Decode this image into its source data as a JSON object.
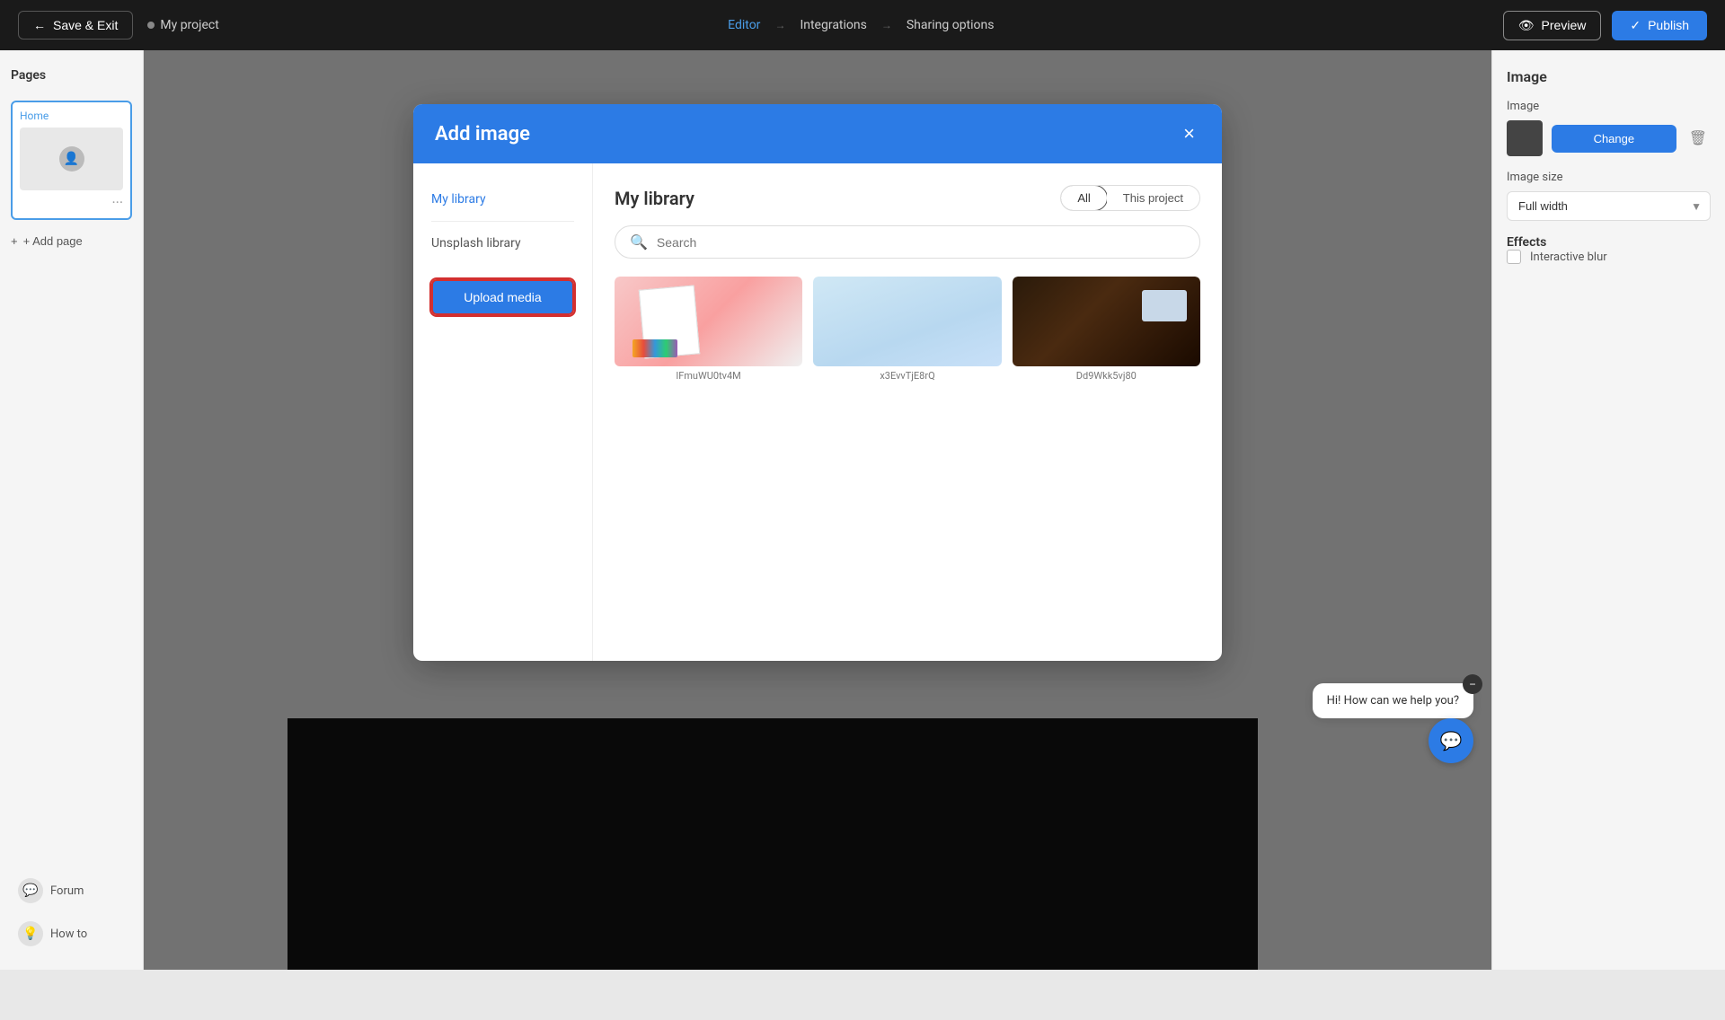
{
  "topNav": {
    "saveExit": "Save & Exit",
    "projectName": "My project",
    "steps": [
      {
        "label": "Editor",
        "active": true
      },
      {
        "label": "Integrations",
        "active": false
      },
      {
        "label": "Sharing options",
        "active": false
      }
    ],
    "preview": "Preview",
    "publish": "Publish"
  },
  "leftSidebar": {
    "title": "Pages",
    "page": {
      "label": "Home"
    },
    "addPage": "+ Add page"
  },
  "rightSidebar": {
    "title": "Image",
    "imageLabel": "Image",
    "changeBtn": "Change",
    "imageSizeLabel": "Image size",
    "imageSizeOption": "Full width",
    "effectsLabel": "Effects",
    "interactiveBlur": "Interactive blur"
  },
  "bottomItems": [
    {
      "label": "Forum",
      "icon": "💬"
    },
    {
      "label": "How to",
      "icon": "💡"
    }
  ],
  "modal": {
    "title": "Add image",
    "closeBtn": "×",
    "navItems": [
      {
        "label": "My library",
        "active": true
      },
      {
        "label": "Unsplash library",
        "active": false
      }
    ],
    "uploadBtn": "Upload media",
    "libraryTitle": "My library",
    "filterAll": "All",
    "filterProject": "This project",
    "searchPlaceholder": "Search",
    "images": [
      {
        "id": "img1",
        "label": "lFmuWU0tv4M"
      },
      {
        "id": "img2",
        "label": "x3EvvTjE8rQ"
      },
      {
        "id": "img3",
        "label": "Dd9Wkk5vj80"
      }
    ]
  },
  "chat": {
    "message": "Hi! How can we help you?"
  }
}
